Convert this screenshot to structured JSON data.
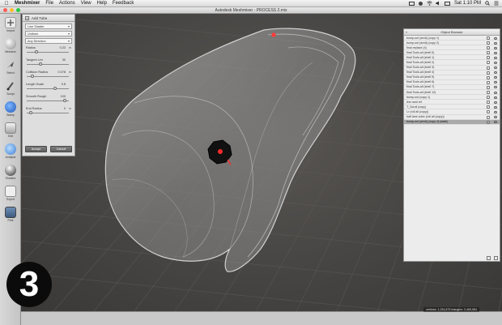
{
  "menubar": {
    "apple_icon": "",
    "app_name": "Meshmixer",
    "items": [
      "File",
      "Actions",
      "View",
      "Help",
      "Feedback"
    ],
    "clock": "Sat 1:10 PM",
    "icons": [
      "screen-sharing-icon",
      "bluetooth-icon",
      "wifi-icon",
      "volume-icon",
      "battery-icon",
      "search-icon",
      "list-icon"
    ]
  },
  "window": {
    "title": "Autodesk Meshmixer - PROCESS 2.mix",
    "traffic_colors": [
      "#fc5f57",
      "#fdbc2e",
      "#28c840"
    ]
  },
  "toolbar": {
    "tools": [
      {
        "label": "Import",
        "icon": "import-plus-icon"
      },
      {
        "label": "Meshmix",
        "icon": "meshmix-ball-icon"
      },
      {
        "label": "Select",
        "icon": "select-arrow-icon"
      },
      {
        "label": "Sculpt",
        "icon": "sculpt-brush-icon"
      },
      {
        "label": "Stamp",
        "icon": "stamp-icon"
      },
      {
        "label": "Edit",
        "icon": "edit-icon"
      },
      {
        "label": "Analysis",
        "icon": "analysis-globe-icon"
      },
      {
        "label": "Shaders",
        "icon": "shaders-sphere-icon"
      },
      {
        "label": "Export",
        "icon": "export-icon"
      },
      {
        "label": "Print",
        "icon": "print-icon"
      }
    ]
  },
  "tool_panel": {
    "title": "Add Tube",
    "dropdowns": [
      "Line Shader",
      "Uniform",
      "Any Direction"
    ],
    "params": [
      {
        "label": "Radius",
        "value": "0.22",
        "unit": "m",
        "level": 0.2
      },
      {
        "label": "Tangent Len",
        "value": "30",
        "unit": "",
        "level": 0.3
      },
      {
        "label": "Collision Radius",
        "value": "0.078",
        "unit": "m",
        "level": 0.1
      },
      {
        "label": "Length Scale",
        "value": "0.8",
        "unit": "",
        "level": 0.65
      },
      {
        "label": "Smooth Rough",
        "value": "100",
        "unit": "",
        "level": 0.9
      },
      {
        "label": "End Radius",
        "value": "0",
        "unit": "m",
        "level": 0.05
      }
    ],
    "accept_label": "Accept",
    "cancel_label": "Cancel"
  },
  "object_browser": {
    "title": "Object Browser",
    "collapse": "«",
    "rows": [
      "bump-out (areA) (copy 1)",
      "bump-out (areA) (copy 2)",
      "final replace (4)",
      "final Tcols-all (shell 0)",
      "final Tcols-all (shell 1)",
      "final Tcols-all (shell 2)",
      "final Tcols-all (shell 3)",
      "final Tcols-all (shell 4)",
      "final Tcols-all (shell 5)",
      "final Tcols-all (shell 6)",
      "final Tcols-all (shell 7)",
      "final Tcols-all (shell 12)",
      "bump-out (copy 1)",
      "line rand ref",
      "T_Scroll (copy)",
      "I-r (roll all (copy))",
      "half lane cubic (roll all (copy))",
      "bump-out (areA) (copy 4) (stalk)"
    ],
    "selected_index": 17
  },
  "status": {
    "text": "vertices: 1,234,879 triangles: 2,469,584"
  },
  "step_number": "3",
  "colors": {
    "mesh": "#bdbdbd",
    "marker_red": "#ff3a3a",
    "badge": "#0b0b0b"
  }
}
